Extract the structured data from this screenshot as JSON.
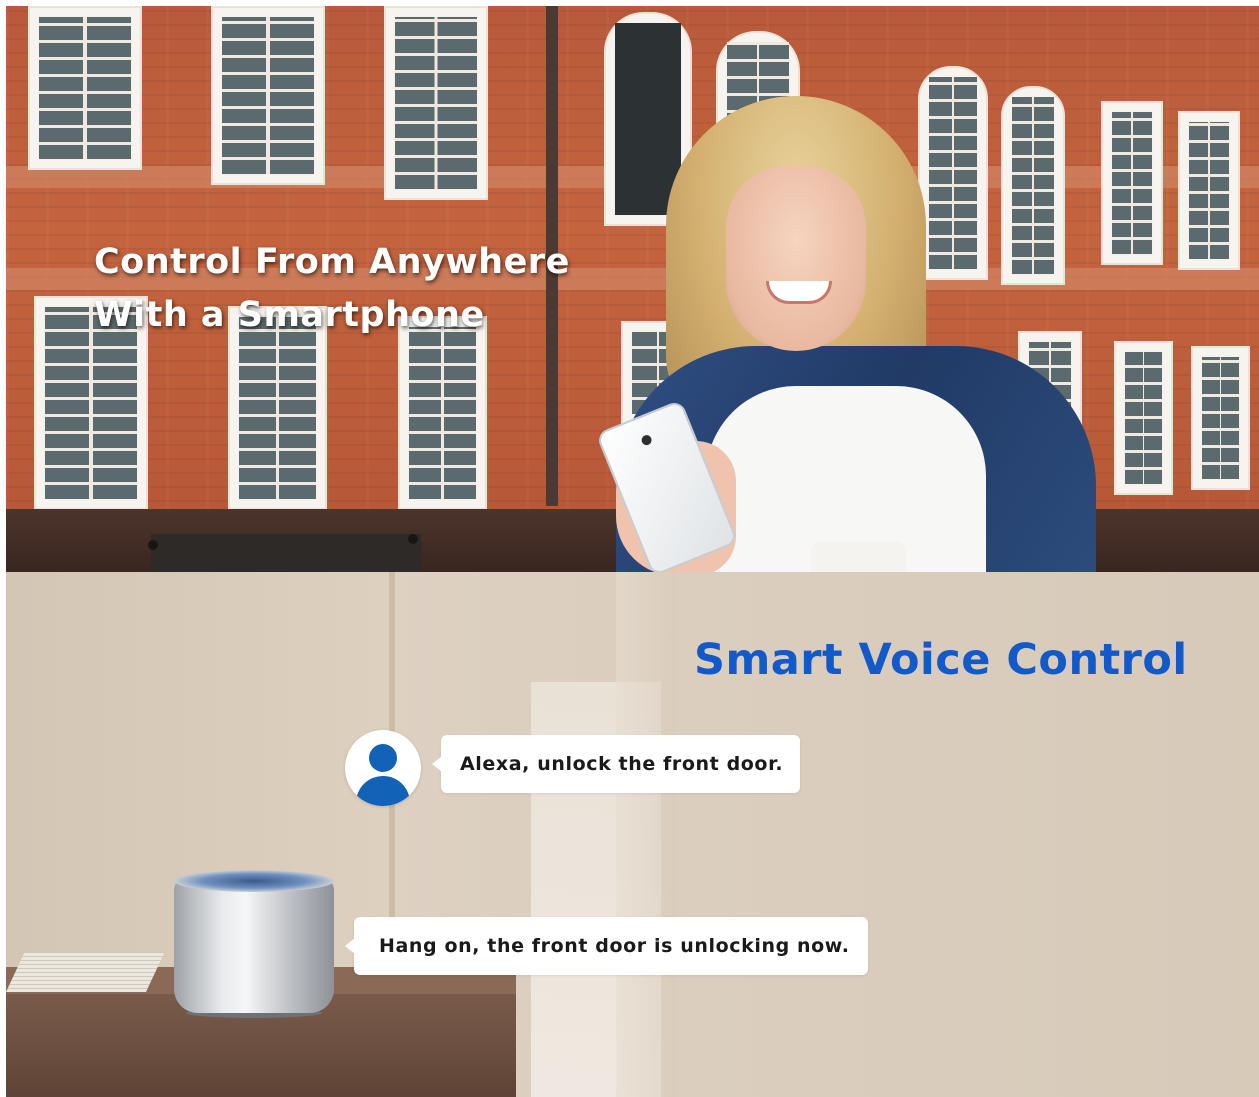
{
  "hero": {
    "title_line1": "Control From Anywhere",
    "title_line2": "With a Smartphone"
  },
  "voice": {
    "title": "Smart Voice Control",
    "user_message": "Alexa, unlock the front door.",
    "assistant_reply": "Hang on, the front door is unlocking now."
  },
  "colors": {
    "voice_title": "#1259c9",
    "avatar": "#1262b7",
    "bubble": "#ffffff"
  },
  "icons": {
    "avatar": "user-avatar-icon"
  }
}
